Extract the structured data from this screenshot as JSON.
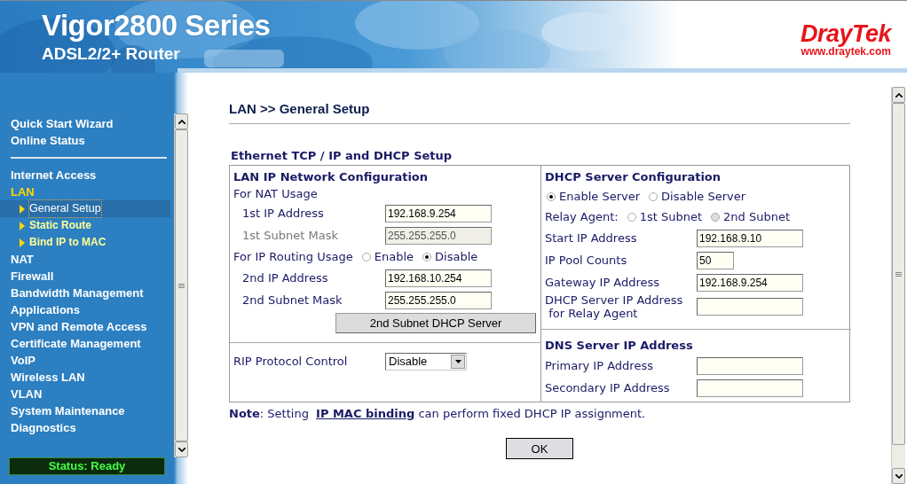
{
  "header": {
    "title": "Vigor2800 Series",
    "subtitle": "ADSL2/2+ Router",
    "logo": "DrayTek",
    "website": "www.draytek.com"
  },
  "sidebar": {
    "top_items": [
      {
        "label": "Quick Start Wizard",
        "selected": false
      },
      {
        "label": "Online Status",
        "selected": false
      }
    ],
    "items": [
      {
        "label": "Internet Access",
        "selected": false
      },
      {
        "label": "LAN",
        "selected": true,
        "children": [
          {
            "label": "General Setup",
            "selected": true
          },
          {
            "label": "Static Route",
            "selected": false
          },
          {
            "label": "Bind IP to MAC",
            "selected": false
          }
        ]
      },
      {
        "label": "NAT",
        "selected": false
      },
      {
        "label": "Firewall",
        "selected": false
      },
      {
        "label": "Bandwidth Management",
        "selected": false
      },
      {
        "label": "Applications",
        "selected": false
      },
      {
        "label": "VPN and Remote Access",
        "selected": false
      },
      {
        "label": "Certificate Management",
        "selected": false
      },
      {
        "label": "VoIP",
        "selected": false
      },
      {
        "label": "Wireless LAN",
        "selected": false
      },
      {
        "label": "VLAN",
        "selected": false
      },
      {
        "label": "System Maintenance",
        "selected": false
      },
      {
        "label": "Diagnostics",
        "selected": false
      }
    ],
    "status": "Status: Ready"
  },
  "page": {
    "breadcrumb": "LAN >> General Setup",
    "section_title": "Ethernet TCP / IP and DHCP Setup",
    "lan": {
      "heading": "LAN IP Network Configuration",
      "nat_label": "For NAT Usage",
      "nat_fields": [
        {
          "label": "1st IP Address",
          "value": "192.168.9.254",
          "disabled": false
        },
        {
          "label": "1st Subnet Mask",
          "value": "255.255.255.0",
          "disabled": true
        }
      ],
      "routing": {
        "label": "For IP Routing Usage",
        "options": [
          {
            "label": "Enable",
            "selected": false
          },
          {
            "label": "Disable",
            "selected": true
          }
        ]
      },
      "routing_fields": [
        {
          "label": "2nd IP Address",
          "value": "192.168.10.254",
          "disabled": false
        },
        {
          "label": "2nd Subnet Mask",
          "value": "255.255.255.0",
          "disabled": false
        }
      ],
      "button": "2nd Subnet DHCP Server",
      "rip": {
        "label": "RIP Protocol Control",
        "value": "Disable"
      }
    },
    "dhcp": {
      "heading": "DHCP Server Configuration",
      "server_options": [
        {
          "label": "Enable Server",
          "selected": true
        },
        {
          "label": "Disable Server",
          "selected": false
        }
      ],
      "relay": {
        "label": "Relay Agent:",
        "options": [
          {
            "label": "1st Subnet",
            "selected": false,
            "disabled": false
          },
          {
            "label": "2nd Subnet",
            "selected": false,
            "disabled": true
          }
        ]
      },
      "fields": [
        {
          "label": "Start IP Address",
          "value": "192.168.9.10",
          "kind": "wide"
        },
        {
          "label": "IP Pool Counts",
          "value": "50",
          "kind": "narrow"
        },
        {
          "label": "Gateway IP Address",
          "value": "192.168.9.254",
          "kind": "wide"
        },
        {
          "label": "DHCP Server IP Address\n for Relay Agent",
          "kind": "wide"
        }
      ],
      "dns_heading": "DNS Server IP Address",
      "dns_fields": [
        {
          "label": "Primary IP Address"
        },
        {
          "label": "Secondary IP Address"
        }
      ]
    },
    "note": {
      "prefix": "**Note**: Setting ",
      "link": "IP MAC binding",
      "suffix": " can perform fixed DHCP IP assignment."
    },
    "ok_button": "OK"
  }
}
